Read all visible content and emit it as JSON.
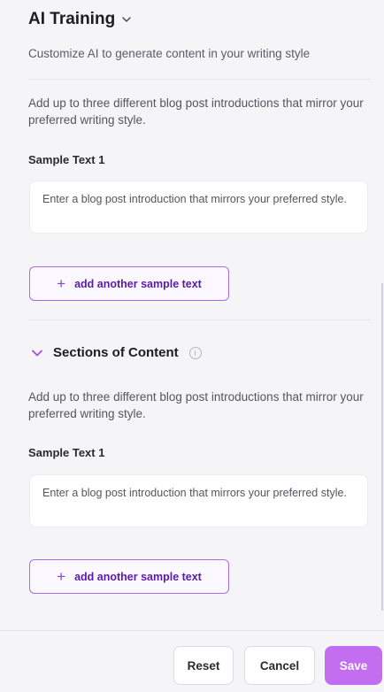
{
  "header": {
    "title": "AI Training",
    "subtitle": "Customize AI to generate content in your writing style"
  },
  "intro_section": {
    "description": "Add up to three different blog post introductions that mirror your preferred writing style.",
    "sample_label": "Sample Text 1",
    "sample_placeholder": "Enter a blog post introduction that mirrors your preferred style.",
    "add_label": "add another sample text"
  },
  "content_section": {
    "title": "Sections of Content",
    "description": "Add up to three different blog post introductions that mirror your preferred writing style.",
    "sample_label": "Sample Text 1",
    "sample_placeholder": "Enter a blog post introduction that mirrors your preferred style.",
    "add_label": "add another sample text"
  },
  "footer": {
    "reset_label": "Reset",
    "cancel_label": "Cancel",
    "save_label": "Save"
  },
  "colors": {
    "accent": "#c36ef0",
    "accent_text": "#5a1aa8",
    "background": "#f5f4f7"
  },
  "icons": {
    "title_toggle": "chevron-down-icon",
    "section_toggle": "chevron-down-icon",
    "info": "info-icon",
    "add": "plus-icon"
  }
}
